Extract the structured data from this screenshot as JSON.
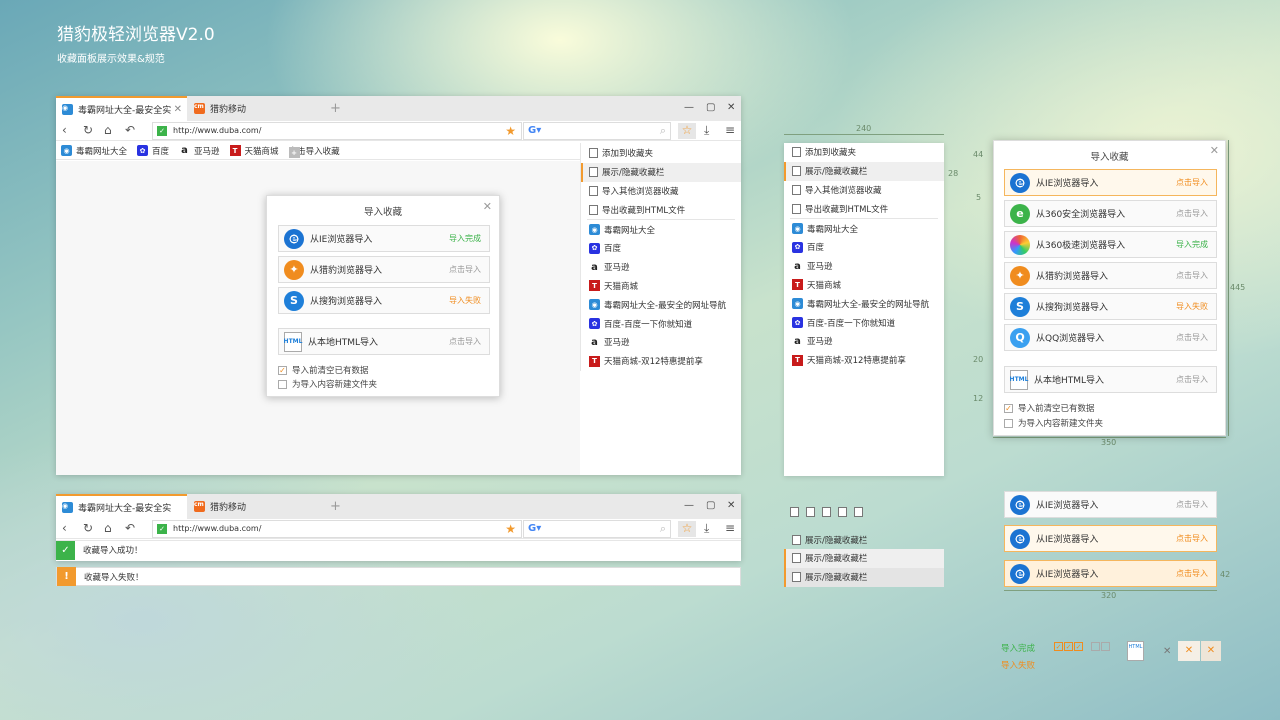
{
  "page": {
    "title": "猎豹极轻浏览器V2.0",
    "subtitle": "收藏面板展示效果&规范"
  },
  "browser": {
    "tab1": "毒霸网址大全-最安全实",
    "tab2": "猎豹移动",
    "url": "http://www.duba.com/",
    "bookmarks": [
      "毒霸网址大全",
      "百度",
      "亚马逊",
      "天猫商城",
      "点击导入收藏"
    ]
  },
  "menu": {
    "actions": [
      "添加到收藏夹",
      "展示/隐藏收藏栏",
      "导入其他浏览器收藏",
      "导出收藏到HTML文件"
    ],
    "items": [
      "毒霸网址大全",
      "百度",
      "亚马逊",
      "天猫商城",
      "毒霸网址大全-最安全的网址导航",
      "百度-百度一下你就知道",
      "亚马逊",
      "天猫商城-双12特惠提前享"
    ]
  },
  "dialog_small": {
    "title": "导入收藏",
    "rows": [
      {
        "label": "从IE浏览器导入",
        "status": "导入完成"
      },
      {
        "label": "从猎豹浏览器导入",
        "status": "点击导入"
      },
      {
        "label": "从搜狗浏览器导入",
        "status": "导入失败"
      },
      {
        "label": "从本地HTML导入",
        "status": "点击导入"
      }
    ],
    "check1": "导入前清空已有数据",
    "check2": "为导入内容新建文件夹"
  },
  "dialog_large": {
    "title": "导入收藏",
    "rows": [
      {
        "label": "从IE浏览器导入",
        "status": "点击导入"
      },
      {
        "label": "从360安全浏览器导入",
        "status": "点击导入"
      },
      {
        "label": "从360极速浏览器导入",
        "status": "导入完成"
      },
      {
        "label": "从猎豹浏览器导入",
        "status": "点击导入"
      },
      {
        "label": "从搜狗浏览器导入",
        "status": "导入失败"
      },
      {
        "label": "从QQ浏览器导入",
        "status": "点击导入"
      },
      {
        "label": "从本地HTML导入",
        "status": "点击导入"
      }
    ],
    "check1": "导入前清空已有数据",
    "check2": "为导入内容新建文件夹"
  },
  "notifications": {
    "success": "收藏导入成功！",
    "fail": "收藏导入失败！"
  },
  "states": {
    "label": "从IE浏览器导入",
    "status": "点击导入",
    "toggle_label": "展示/隐藏收藏栏"
  },
  "legend": {
    "ok": "导入完成",
    "fail": "导入失败"
  },
  "dims": {
    "w240": "240",
    "h44": "44",
    "h28": "28",
    "h5": "5",
    "h20": "20",
    "h12": "12",
    "h445": "445",
    "w350": "350",
    "w320": "320",
    "h42": "42"
  },
  "colors": {
    "accent": "#f29a2e",
    "success": "#3cb34a",
    "fail": "#f08c1e"
  }
}
